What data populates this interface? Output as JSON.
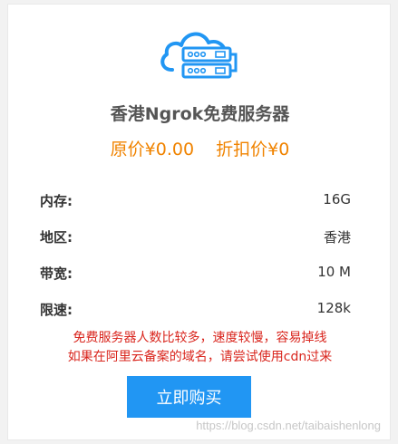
{
  "product": {
    "title": "香港Ngrok免费服务器",
    "original_price": "原价¥0.00",
    "discount_price": "折扣价¥0"
  },
  "specs": [
    {
      "label": "内存:",
      "value": "16G"
    },
    {
      "label": "地区:",
      "value": "香港"
    },
    {
      "label": "带宽:",
      "value": "10 M"
    },
    {
      "label": "限速:",
      "value": "128k"
    }
  ],
  "notice": {
    "line1": "免费服务器人数比较多，速度较慢，容易掉线",
    "line2": "如果在阿里云备案的域名，请尝试使用cdn过来"
  },
  "buy_button": {
    "label": "立即购买"
  },
  "watermark": "https://blog.csdn.net/taibaishenlong",
  "icon": {
    "name": "cloud-server-icon"
  },
  "colors": {
    "accent": "#2196f3",
    "price": "#f08300",
    "notice": "#d9251d"
  }
}
